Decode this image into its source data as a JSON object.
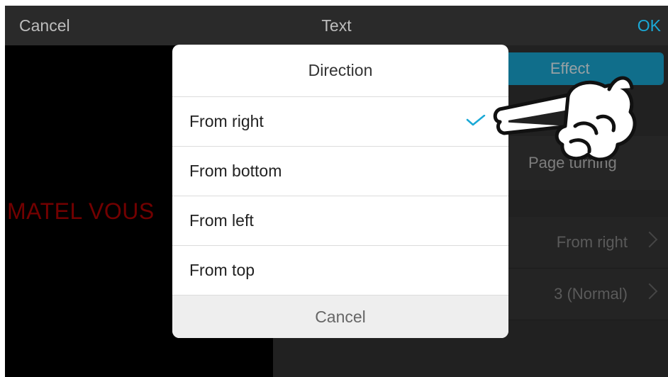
{
  "topbar": {
    "cancel": "Cancel",
    "title": "Text",
    "ok": "OK"
  },
  "preview": {
    "text": "MATEL VOUS"
  },
  "panel": {
    "segment_right": "Effect",
    "effect_option": "Page turning",
    "direction_value": "From right",
    "speed_value": "3 (Normal)"
  },
  "dialog": {
    "title": "Direction",
    "options": [
      {
        "label": "From right",
        "selected": true
      },
      {
        "label": "From bottom",
        "selected": false
      },
      {
        "label": "From left",
        "selected": false
      },
      {
        "label": "From top",
        "selected": false
      }
    ],
    "cancel": "Cancel"
  },
  "colors": {
    "accent": "#1aa9d6",
    "preview_text": "#b00000"
  },
  "icons": {
    "check": "check-icon",
    "chevron": "chevron-right-icon",
    "pointer": "hand-pointer-icon"
  }
}
